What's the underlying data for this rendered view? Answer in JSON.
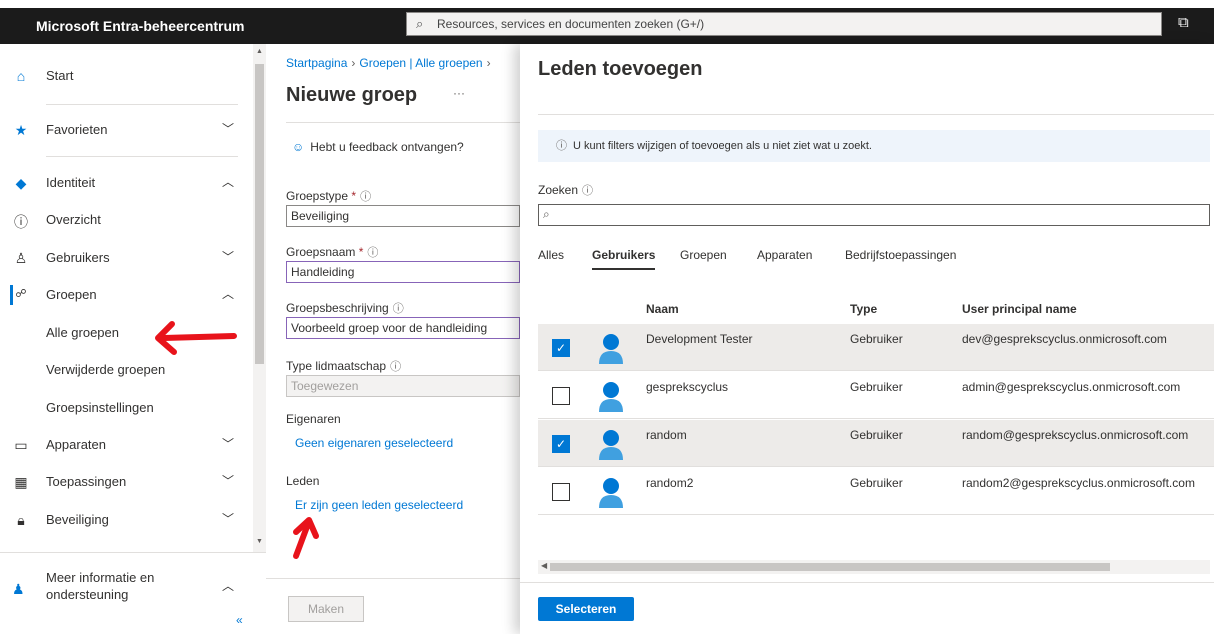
{
  "topbar": {
    "brand": "Microsoft Entra-beheercentrum",
    "search_placeholder": "Resources, services en documenten zoeken (G+/)"
  },
  "sidebar": {
    "items": [
      {
        "label": "Start",
        "icon": "home-icon"
      },
      {
        "label": "Favorieten",
        "icon": "star-icon"
      },
      {
        "label": "Identiteit",
        "icon": "identity-icon"
      },
      {
        "label": "Overzicht",
        "icon": "info-icon"
      },
      {
        "label": "Gebruikers",
        "icon": "user-icon"
      },
      {
        "label": "Groepen",
        "icon": "groups-icon"
      },
      {
        "label": "Alle groepen"
      },
      {
        "label": "Verwijderde groepen"
      },
      {
        "label": "Groepsinstellingen"
      },
      {
        "label": "Apparaten",
        "icon": "devices-icon"
      },
      {
        "label": "Toepassingen",
        "icon": "apps-icon"
      },
      {
        "label": "Beveiliging",
        "icon": "lock-icon"
      }
    ],
    "bottom_label": "Meer informatie en ondersteuning",
    "collapse": "«"
  },
  "form": {
    "breadcrumb": [
      "Startpagina",
      "Groepen | Alle groepen"
    ],
    "title": "Nieuwe groep",
    "more": "···",
    "feedback": "Hebt u feedback ontvangen?",
    "groepstype_label": "Groepstype",
    "groepstype_value": "Beveiliging",
    "groepsnaam_label": "Groepsnaam",
    "groepsnaam_value": "Handleiding",
    "beschrijving_label": "Groepsbeschrijving",
    "beschrijving_value": "Voorbeeld groep voor de handleiding",
    "lidmaatschap_label": "Type lidmaatschap",
    "lidmaatschap_value": "Toegewezen",
    "eigenaren_label": "Eigenaren",
    "eigenaren_link": "Geen eigenaren geselecteerd",
    "leden_label": "Leden",
    "leden_link": "Er zijn geen leden geselecteerd",
    "create_button": "Maken"
  },
  "panel": {
    "title": "Leden toevoegen",
    "info": "U kunt filters wijzigen of toevoegen als u niet ziet wat u zoekt.",
    "search_label": "Zoeken",
    "tabs": [
      "Alles",
      "Gebruikers",
      "Groepen",
      "Apparaten",
      "Bedrijfstoepassingen"
    ],
    "active_tab": "Gebruikers",
    "columns": [
      "Naam",
      "Type",
      "User principal name"
    ],
    "rows": [
      {
        "name": "Development Tester",
        "type": "Gebruiker",
        "upn": "dev@gesprekscyclus.onmicrosoft.com",
        "checked": true
      },
      {
        "name": "gesprekscyclus",
        "type": "Gebruiker",
        "upn": "admin@gesprekscyclus.onmicrosoft.com",
        "checked": false
      },
      {
        "name": "random",
        "type": "Gebruiker",
        "upn": "random@gesprekscyclus.onmicrosoft.com",
        "checked": true
      },
      {
        "name": "random2",
        "type": "Gebruiker",
        "upn": "random2@gesprekscyclus.onmicrosoft.com",
        "checked": false
      }
    ],
    "select_button": "Selecteren"
  },
  "colors": {
    "accent": "#0078d4",
    "annotation": "#e8131b"
  }
}
